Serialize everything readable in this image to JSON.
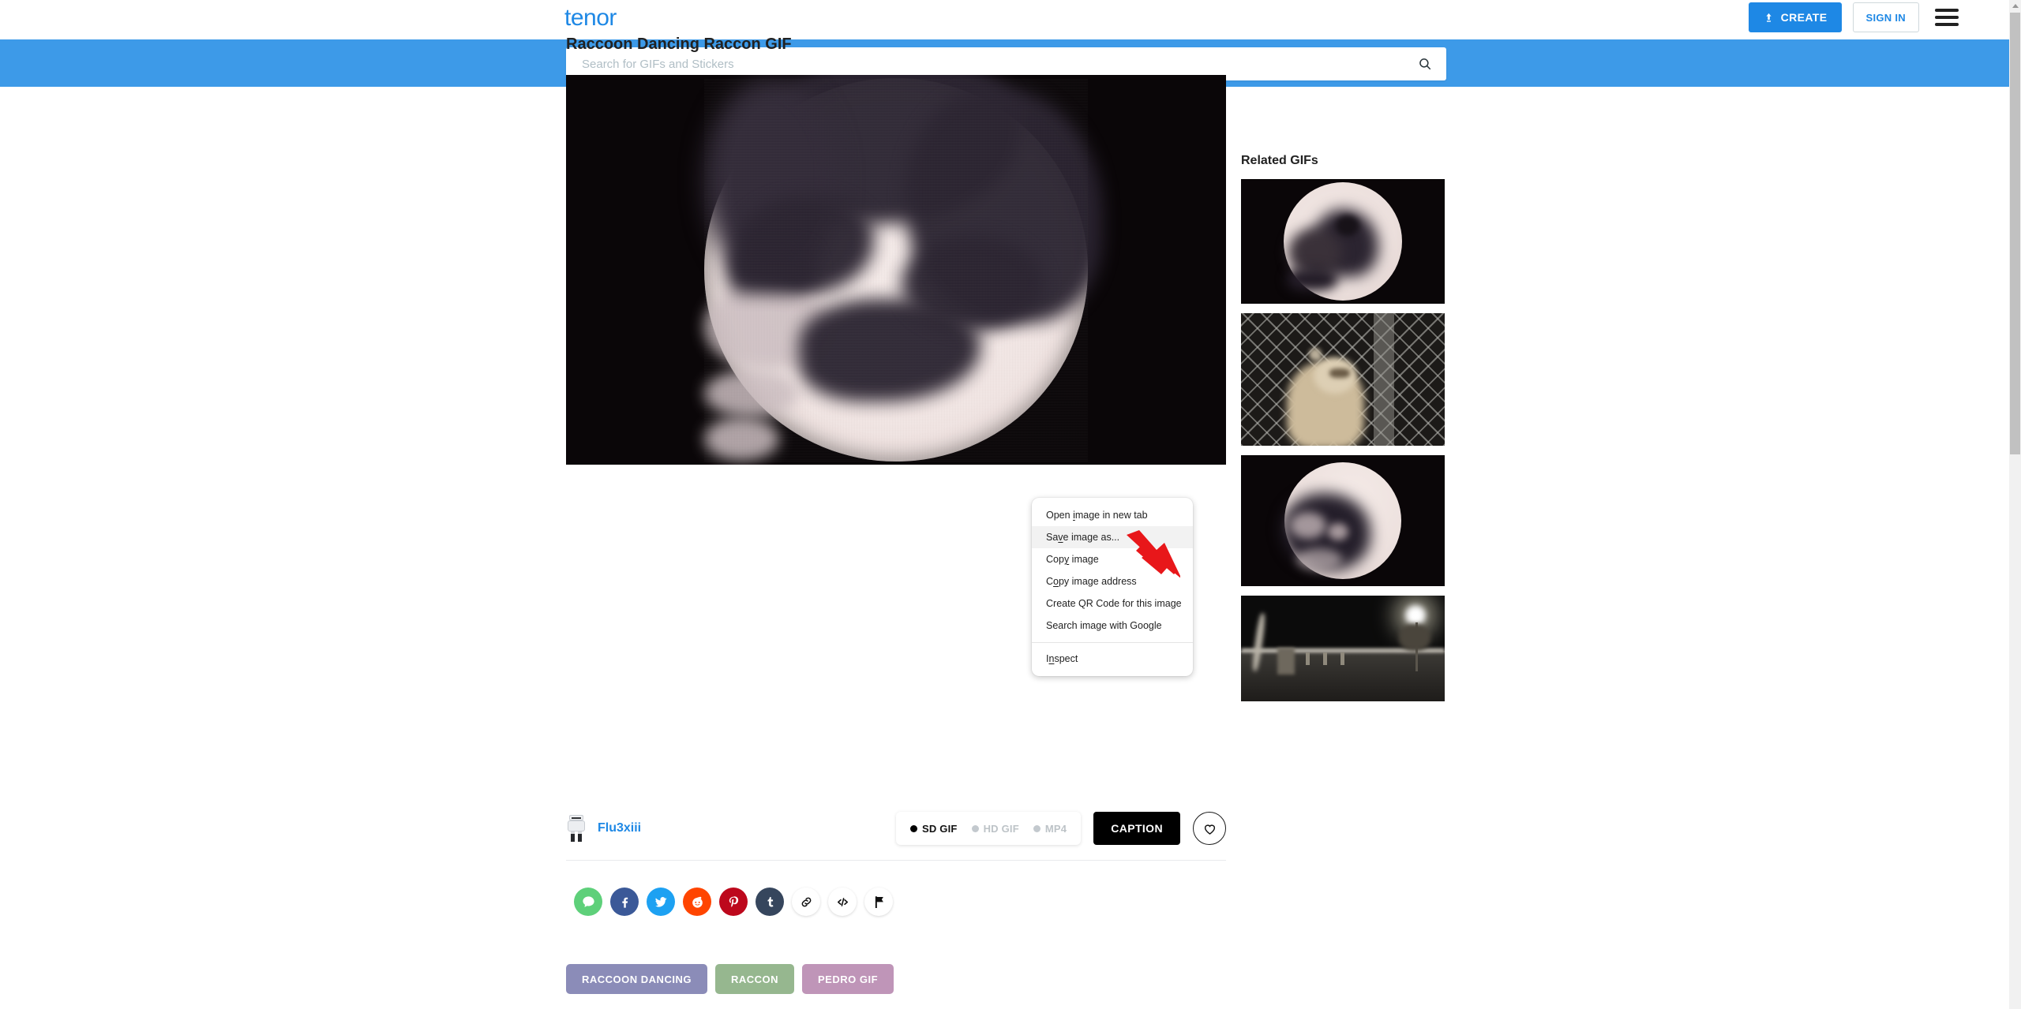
{
  "header": {
    "logo": "tenor",
    "create_label": "CREATE",
    "signin_label": "SIGN IN",
    "create_icon": "upload-icon",
    "menu_icon": "hamburger-menu-icon",
    "accent_color": "#1e88e5"
  },
  "search": {
    "placeholder": "Search for GIFs and Stickers",
    "value": "",
    "icon": "search-icon",
    "band_color": "#3d9ae8"
  },
  "main": {
    "page_title": "Raccoon Dancing Raccon GIF",
    "gif_alt": "raccoon dancing in circular vignette"
  },
  "context_menu": {
    "items": [
      {
        "label": "Open image in new tab",
        "accel_index": 5,
        "highlighted": false
      },
      {
        "label": "Save image as...",
        "accel_index": 2,
        "highlighted": true
      },
      {
        "label": "Copy image",
        "accel_index": 3,
        "highlighted": false
      },
      {
        "label": "Copy image address",
        "accel_index": 1,
        "highlighted": false
      },
      {
        "label": "Create QR Code for this image",
        "accel_index": -1,
        "highlighted": false
      },
      {
        "label": "Search image with Google",
        "accel_index": -1,
        "highlighted": false
      }
    ],
    "footer_item": {
      "label": "Inspect",
      "accel_index": 1
    }
  },
  "annotation": {
    "arrow": "red-arrow-pointer",
    "color": "#e8171a",
    "points_to": "Save image as..."
  },
  "author": {
    "name": "Flu3xiii",
    "avatar": "user-avatar"
  },
  "formats": [
    {
      "label": "SD GIF",
      "selected": true
    },
    {
      "label": "HD GIF",
      "selected": false
    },
    {
      "label": "MP4",
      "selected": false
    }
  ],
  "actions": {
    "caption_label": "CAPTION",
    "favorite_icon": "heart-icon"
  },
  "share": [
    {
      "name": "message-share-button",
      "icon": "message-icon",
      "class": "sb-msg"
    },
    {
      "name": "facebook-share-button",
      "icon": "facebook-icon",
      "class": "sb-fb"
    },
    {
      "name": "twitter-share-button",
      "icon": "twitter-icon",
      "class": "sb-tw"
    },
    {
      "name": "reddit-share-button",
      "icon": "reddit-icon",
      "class": "sb-rd"
    },
    {
      "name": "pinterest-share-button",
      "icon": "pinterest-icon",
      "class": "sb-pn"
    },
    {
      "name": "tumblr-share-button",
      "icon": "tumblr-icon",
      "class": "sb-tm"
    },
    {
      "name": "copy-link-button",
      "icon": "link-icon",
      "class": "sb-plain"
    },
    {
      "name": "embed-code-button",
      "icon": "code-icon",
      "class": "sb-plain"
    },
    {
      "name": "report-button",
      "icon": "flag-icon",
      "class": "sb-plain"
    }
  ],
  "tags": [
    {
      "label": "RACCOON DANCING",
      "color": "#8b8cb8"
    },
    {
      "label": "RACCON",
      "color": "#96b78f"
    },
    {
      "label": "PEDRO GIF",
      "color": "#bf95b8"
    }
  ],
  "related": {
    "title": "Related GIFs",
    "items": [
      {
        "alt": "raccoon closeup in circular vignette",
        "kind": "circle-dark"
      },
      {
        "alt": "raccoon behind chain link fence",
        "kind": "fence"
      },
      {
        "alt": "raccoon face in circular vignette",
        "kind": "circle-dark-2"
      },
      {
        "alt": "night street scene with street lamp",
        "kind": "night-street"
      }
    ]
  }
}
